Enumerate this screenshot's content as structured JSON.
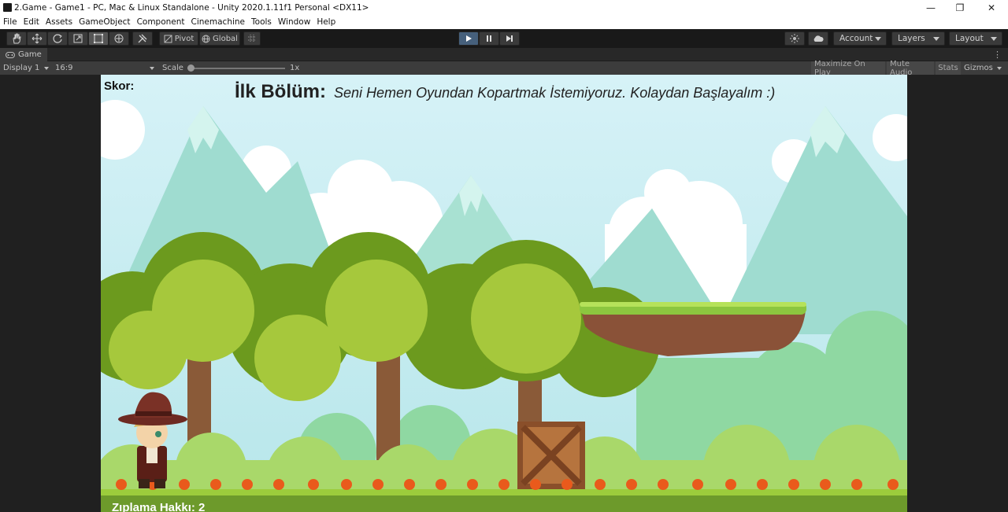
{
  "window": {
    "title": "2.Game - Game1 - PC, Mac & Linux Standalone - Unity 2020.1.11f1 Personal <DX11>",
    "controls": [
      "—",
      "❐",
      "✕"
    ]
  },
  "menu": [
    "File",
    "Edit",
    "Assets",
    "GameObject",
    "Component",
    "Cinemachine",
    "Tools",
    "Window",
    "Help"
  ],
  "toolbar": {
    "pivot": "Pivot",
    "global": "Global",
    "account": "Account",
    "layers": "Layers",
    "layout": "Layout"
  },
  "game_tab": {
    "label": "Game"
  },
  "game_toolbar": {
    "display": "Display 1",
    "aspect": "16:9",
    "scale_label": "Scale",
    "scale_value": "1x",
    "maximize": "Maximize On Play",
    "mute": "Mute Audio",
    "stats": "Stats",
    "gizmos": "Gizmos"
  },
  "game": {
    "score_label": "Skor:",
    "level_title": "İlk Bölüm:",
    "level_subtitle": "Seni Hemen Oyundan Kopartmak İstemiyoruz. Kolaydan Başlayalım :)",
    "jump_label": "Zıplama Hakkı:  2"
  },
  "colors": {
    "play_active": "#46607c",
    "editor_bg": "#282828",
    "sky": "#cfeef6",
    "grass": "#8cc63f"
  }
}
